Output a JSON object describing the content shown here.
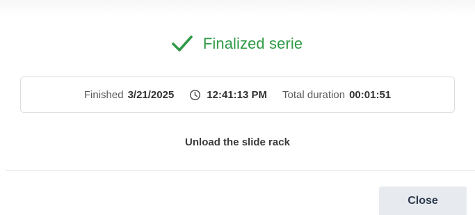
{
  "dialog": {
    "title": "Finalized serie",
    "success_color": "#2f9a46",
    "icons": {
      "status": "checkmark-icon",
      "time": "clock-icon"
    },
    "finished_label": "Finished",
    "finished_date": "3/21/2025",
    "finished_time": "12:41:13 PM",
    "duration_label": "Total duration",
    "duration_value": "00:01:51",
    "instruction": "Unload the slide rack",
    "close_label": "Close"
  }
}
